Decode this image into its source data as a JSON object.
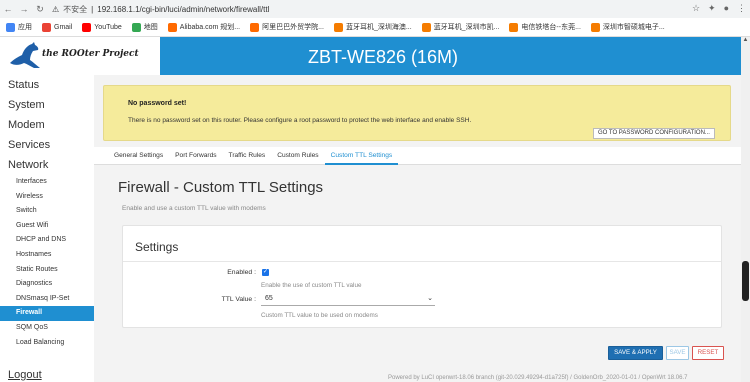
{
  "browser": {
    "security_label": "不安全",
    "url": "192.168.1.1/cgi-bin/luci/admin/network/firewall/ttl",
    "bookmarks": [
      {
        "label": "应用",
        "color": "#4285f4"
      },
      {
        "label": "Gmail",
        "color": "#ea4335"
      },
      {
        "label": "YouTube",
        "color": "#ff0000"
      },
      {
        "label": "地图",
        "color": "#34a853"
      },
      {
        "label": "Alibaba.com 规划...",
        "color": "#ff6a00"
      },
      {
        "label": "阿里巴巴外贸学院...",
        "color": "#ff6a00"
      },
      {
        "label": "蓝牙耳机_深圳海澳...",
        "color": "#f57c00"
      },
      {
        "label": "蓝牙耳机_深圳市凯...",
        "color": "#f57c00"
      },
      {
        "label": "电信铁塔台--东莞...",
        "color": "#f57c00"
      },
      {
        "label": "深圳市智硕城电子...",
        "color": "#f57c00"
      }
    ]
  },
  "header": {
    "logo_text": "the ROOter Project",
    "device_name": "ZBT-WE826 (16M)"
  },
  "sidebar": {
    "main": [
      {
        "label": "Status"
      },
      {
        "label": "System"
      },
      {
        "label": "Modem"
      },
      {
        "label": "Services"
      },
      {
        "label": "Network"
      }
    ],
    "network_items": [
      {
        "label": "Interfaces",
        "active": false
      },
      {
        "label": "Wireless",
        "active": false
      },
      {
        "label": "Switch",
        "active": false
      },
      {
        "label": "Guest Wifi",
        "active": false
      },
      {
        "label": "DHCP and DNS",
        "active": false
      },
      {
        "label": "Hostnames",
        "active": false
      },
      {
        "label": "Static Routes",
        "active": false
      },
      {
        "label": "Diagnostics",
        "active": false
      },
      {
        "label": "DNSmasq IP-Set",
        "active": false
      },
      {
        "label": "Firewall",
        "active": true
      },
      {
        "label": "SQM QoS",
        "active": false
      },
      {
        "label": "Load Balancing",
        "active": false
      }
    ],
    "logout": "Logout"
  },
  "notice": {
    "title": "No password set!",
    "text": "There is no password set on this router. Please configure a root password to protect the web interface and enable SSH.",
    "button": "GO TO PASSWORD CONFIGURATION..."
  },
  "tabs": [
    {
      "label": "General Settings",
      "active": false
    },
    {
      "label": "Port Forwards",
      "active": false
    },
    {
      "label": "Traffic Rules",
      "active": false
    },
    {
      "label": "Custom Rules",
      "active": false
    },
    {
      "label": "Custom TTL Settings",
      "active": true
    }
  ],
  "page": {
    "title": "Firewall - Custom TTL Settings",
    "description": "Enable and use a custom TTL value with modems"
  },
  "settings": {
    "title": "Settings",
    "enabled_label": "Enabled :",
    "enabled_checked": true,
    "enabled_hint": "Enable the use of custom TTL value",
    "ttl_label": "TTL Value :",
    "ttl_value": "65",
    "ttl_hint": "Custom TTL value to be used on modems"
  },
  "actions": {
    "save_apply": "SAVE & APPLY",
    "save": "SAVE",
    "reset": "RESET"
  },
  "footer": "Powered by LuCI openwrt-18.06 branch (git-20.029.49294-d1a725f) / GoldenOrb_2020-01-01 / OpenWrt 18.06.7"
}
